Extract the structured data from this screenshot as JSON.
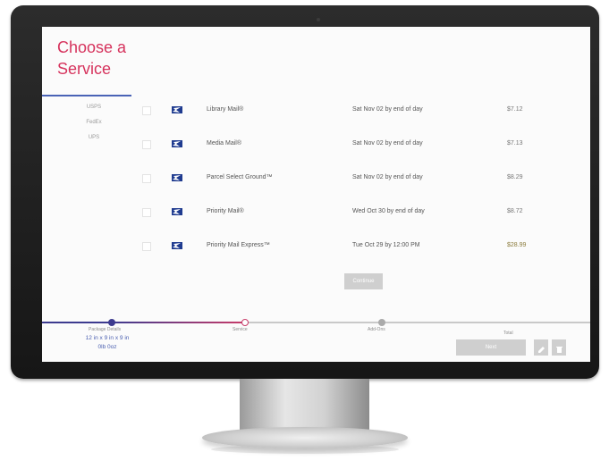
{
  "page": {
    "title_line1": "Choose a",
    "title_line2": "Service"
  },
  "carriers": [
    {
      "label": "USPS"
    },
    {
      "label": "FedEx"
    },
    {
      "label": "UPS"
    }
  ],
  "services": [
    {
      "name": "Library Mail®",
      "delivery": "Sat Nov 02 by end of day",
      "price": "$7.12",
      "logo": "usps-eagle-icon"
    },
    {
      "name": "Media Mail®",
      "delivery": "Sat Nov 02 by end of day",
      "price": "$7.13",
      "logo": "usps-eagle-icon"
    },
    {
      "name": "Parcel Select Ground™",
      "delivery": "Sat Nov 02 by end of day",
      "price": "$8.29",
      "logo": "usps-eagle-icon"
    },
    {
      "name": "Priority Mail®",
      "delivery": "Wed Oct 30 by end of day",
      "price": "$8.72",
      "logo": "usps-eagle-icon"
    },
    {
      "name": "Priority Mail Express™",
      "delivery": "Tue Oct 29 by 12:00 PM",
      "price": "$28.99",
      "logo": "usps-eagle-icon"
    }
  ],
  "actions": {
    "continue_label": "Continue",
    "next_label": "Next"
  },
  "steps": {
    "package_label": "Package Details",
    "service_label": "Service",
    "add_ons_label": "Add-Ons",
    "package_size": "12 in x 9 in x 9 in",
    "package_weight": "0lb  0oz",
    "total_label": "Total"
  },
  "icons": {
    "edit": "pencil-icon",
    "delete": "trash-icon"
  },
  "colors": {
    "title": "#d6335d",
    "progress_done": "#3d3b8f",
    "progress_active": "#c83c6a",
    "usps_blue": "#1f3b8f",
    "package_text": "#4a5fb0"
  }
}
